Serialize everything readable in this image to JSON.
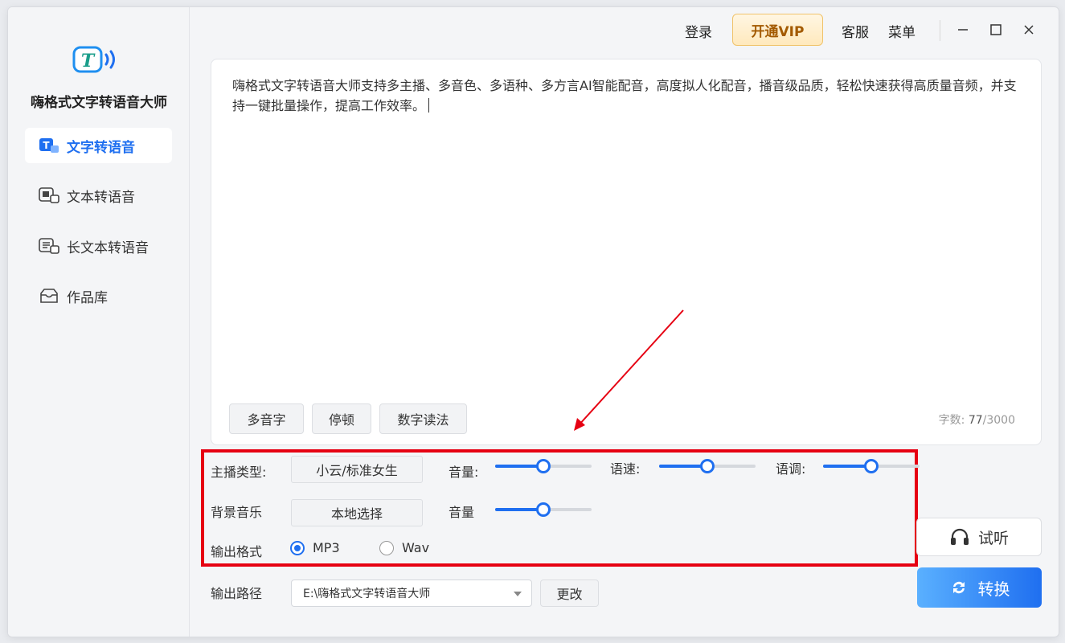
{
  "app": {
    "title": "嗨格式文字转语音大师"
  },
  "sidebar": {
    "items": [
      {
        "label": "文字转语音",
        "icon": "text-to-speech-icon",
        "active": true
      },
      {
        "label": "文本转语音",
        "icon": "file-to-speech-icon",
        "active": false
      },
      {
        "label": "长文本转语音",
        "icon": "long-text-icon",
        "active": false
      },
      {
        "label": "作品库",
        "icon": "inbox-icon",
        "active": false
      }
    ]
  },
  "header": {
    "login": "登录",
    "vip": "开通VIP",
    "service": "客服",
    "menu": "菜单"
  },
  "editor": {
    "text": "嗨格式文字转语音大师支持多主播、多音色、多语种、多方言AI智能配音，高度拟人化配音，播音级品质，轻松快速获得高质量音频，并支持一键批量操作，提高工作效率。",
    "tools": [
      "多音字",
      "停顿",
      "数字读法"
    ],
    "counter_label": "字数:",
    "count": "77",
    "max": "/3000"
  },
  "settings": {
    "anchor_label": "主播类型:",
    "anchor_value": "小云/标准女生",
    "volume_label": "音量:",
    "volume_level": 0.5,
    "speed_label": "语速:",
    "speed_level": 0.5,
    "pitch_label": "语调:",
    "pitch_level": 0.5,
    "bgm_label": "背景音乐",
    "bgm_value": "本地选择",
    "bgm_volume_label": "音量",
    "bgm_volume_level": 0.5,
    "format_label": "输出格式",
    "formats": [
      {
        "label": "MP3",
        "selected": true
      },
      {
        "label": "Wav",
        "selected": false
      }
    ],
    "path_label": "输出路径",
    "path_value": "E:\\嗨格式文字转语音大师",
    "change_label": "更改"
  },
  "actions": {
    "listen": "试听",
    "convert": "转换"
  },
  "colors": {
    "accent": "#1f6ff0",
    "highlight_box": "#e60012",
    "vip_text": "#a35a00"
  }
}
